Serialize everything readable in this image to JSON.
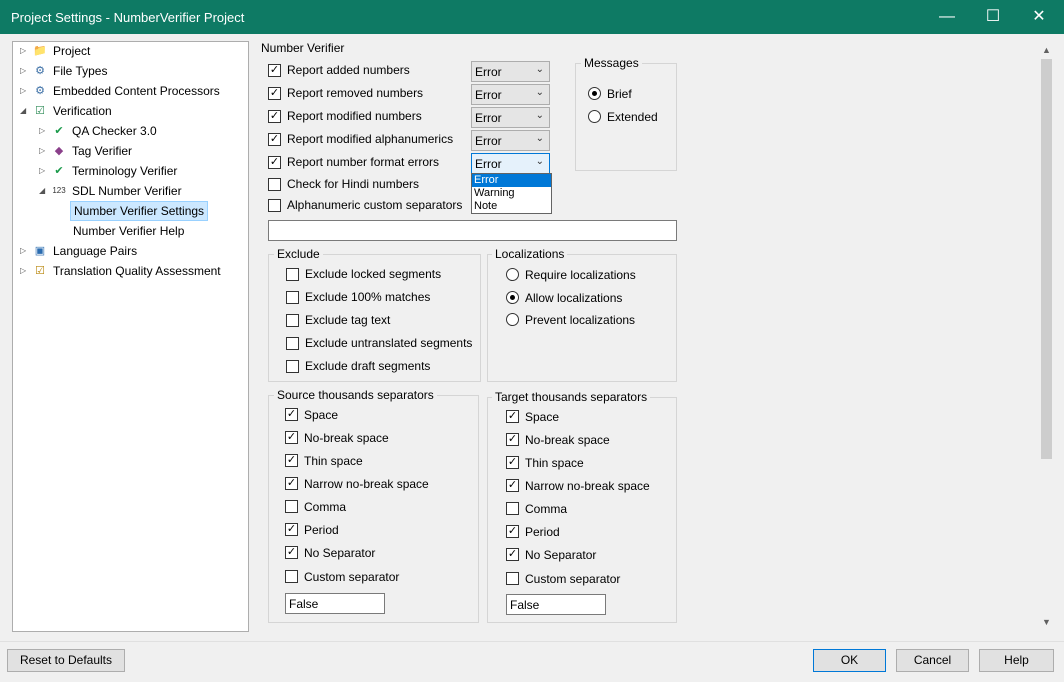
{
  "window": {
    "title": "Project Settings - NumberVerifier Project",
    "minimize": "—",
    "maximize": "☐",
    "close": "✕"
  },
  "tree": [
    {
      "label": "Project",
      "arrow": "▷",
      "icon": "📁"
    },
    {
      "label": "File Types",
      "arrow": "▷",
      "icon": "⚙"
    },
    {
      "label": "Embedded Content Processors",
      "arrow": "▷",
      "icon": "⚙"
    },
    {
      "label": "Verification",
      "arrow": "◢",
      "icon": "☑"
    },
    {
      "label": "QA Checker 3.0",
      "arrow": "▷",
      "icon": "✔"
    },
    {
      "label": "Tag Verifier",
      "arrow": "▷",
      "icon": "◆"
    },
    {
      "label": "Terminology Verifier",
      "arrow": "▷",
      "icon": "✔"
    },
    {
      "label": "SDL Number Verifier",
      "arrow": "◢",
      "icon": "123"
    },
    {
      "label": "Number Verifier Settings",
      "arrow": "",
      "icon": ""
    },
    {
      "label": "Number Verifier Help",
      "arrow": "",
      "icon": ""
    },
    {
      "label": "Language Pairs",
      "arrow": "▷",
      "icon": "▣"
    },
    {
      "label": "Translation Quality Assessment",
      "arrow": "▷",
      "icon": "☑"
    }
  ],
  "nv": {
    "group_title": "Number Verifier",
    "checks": [
      {
        "label": "Report added numbers",
        "checked": true,
        "level": "Error"
      },
      {
        "label": "Report removed numbers",
        "checked": true,
        "level": "Error"
      },
      {
        "label": "Report modified numbers",
        "checked": true,
        "level": "Error"
      },
      {
        "label": "Report modified alphanumerics",
        "checked": true,
        "level": "Error"
      },
      {
        "label": "Report number format errors",
        "checked": true,
        "level": "Error"
      },
      {
        "label": "Check for Hindi numbers",
        "checked": false
      },
      {
        "label": "Alphanumeric custom separators",
        "checked": false
      }
    ],
    "custom_separators_value": "",
    "dropdown_options": [
      "Error",
      "Warning",
      "Note"
    ]
  },
  "messages": {
    "title": "Messages",
    "options": [
      {
        "label": "Brief",
        "selected": true
      },
      {
        "label": "Extended",
        "selected": false
      }
    ]
  },
  "exclude": {
    "title": "Exclude",
    "items": [
      {
        "label": "Exclude locked segments",
        "checked": false
      },
      {
        "label": "Exclude 100% matches",
        "checked": false
      },
      {
        "label": "Exclude tag text",
        "checked": false
      },
      {
        "label": "Exclude untranslated segments",
        "checked": false
      },
      {
        "label": "Exclude draft segments",
        "checked": false
      }
    ]
  },
  "localizations": {
    "title": "Localizations",
    "options": [
      {
        "label": "Require localizations",
        "selected": false
      },
      {
        "label": "Allow localizations",
        "selected": true
      },
      {
        "label": "Prevent localizations",
        "selected": false
      }
    ]
  },
  "source_sep": {
    "title": "Source thousands separators",
    "items": [
      {
        "label": "Space",
        "checked": true
      },
      {
        "label": "No-break space",
        "checked": true
      },
      {
        "label": "Thin space",
        "checked": true
      },
      {
        "label": "Narrow no-break space",
        "checked": true
      },
      {
        "label": "Comma",
        "checked": false
      },
      {
        "label": "Period",
        "checked": true
      },
      {
        "label": "No Separator",
        "checked": true
      },
      {
        "label": "Custom separator",
        "checked": false
      }
    ],
    "custom_value": "False"
  },
  "target_sep": {
    "title": "Target thousands separators",
    "items": [
      {
        "label": "Space",
        "checked": true
      },
      {
        "label": "No-break space",
        "checked": true
      },
      {
        "label": "Thin space",
        "checked": true
      },
      {
        "label": "Narrow no-break space",
        "checked": true
      },
      {
        "label": "Comma",
        "checked": false
      },
      {
        "label": "Period",
        "checked": true
      },
      {
        "label": "No Separator",
        "checked": true
      },
      {
        "label": "Custom separator",
        "checked": false
      }
    ],
    "custom_value": "False"
  },
  "buttons": {
    "reset": "Reset to Defaults",
    "ok": "OK",
    "cancel": "Cancel",
    "help": "Help"
  },
  "colors": {
    "titlebar": "#0e7a64",
    "selection": "#0078d7"
  }
}
